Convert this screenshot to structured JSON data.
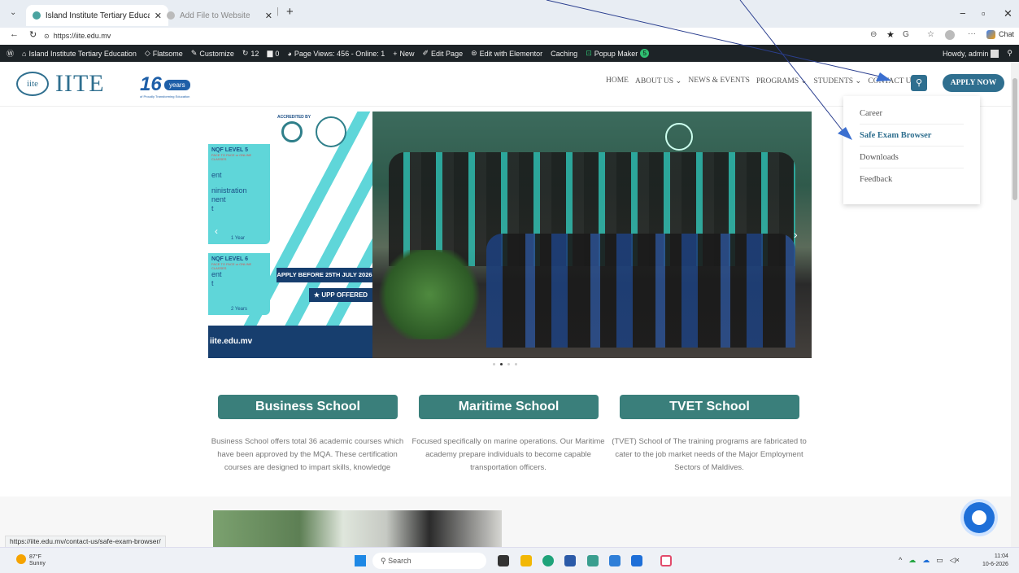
{
  "browser": {
    "active_tab": "Island Institute Tertiary Education",
    "inactive_tab": "Add File to Website",
    "new_tab": "+",
    "url": "https://iite.edu.mv",
    "chat_label": "Chat"
  },
  "wp_admin_bar": {
    "site_name": "Island Institute Tertiary Education",
    "theme": "Flatsome",
    "customize": "Customize",
    "updates": "12",
    "comments": "0",
    "page_views": "Page Views: 456 - Online: 1",
    "new": "New",
    "edit_page": "Edit Page",
    "edit_elementor": "Edit with Elementor",
    "caching": "Caching",
    "popup_maker": "Popup Maker",
    "popup_count": "5",
    "howdy": "Howdy, admin"
  },
  "header": {
    "logo_text": "IITE",
    "years_num": "16",
    "years_label": "years",
    "years_sub": "of Proudly Transforming Education",
    "nav": [
      "HOME",
      "ABOUT US ⌄",
      "NEWS & EVENTS",
      "PROGRAMS ⌄",
      "STUDENTS ⌄",
      "CONTACT US ⌄"
    ],
    "apply_label": "APPLY NOW"
  },
  "dropdown": {
    "items": [
      "Career",
      "Safe Exam Browser",
      "Downloads",
      "Feedback"
    ]
  },
  "hero": {
    "accredited": "ACCREDITED BY",
    "card1": {
      "level": "NQF LEVEL 5",
      "tag": "FACE TO FACE or ONLINE CLASSES",
      "lines": [
        "ent",
        "ninistration",
        "nent",
        "t"
      ],
      "duration": "1 Year"
    },
    "card2": {
      "level": "NQF LEVEL 6",
      "tag": "FACE TO FACE or ONLINE CLASSES",
      "lines": [
        "ent",
        "t"
      ],
      "duration": "2 Years"
    },
    "apply_before": "APPLY BEFORE 25TH JULY 2026",
    "upp": "★ UPP OFFERED",
    "site": "iite.edu.mv"
  },
  "schools": [
    {
      "name": "Business School",
      "desc": "Business School offers total 36 academic courses which have been approved by the MQA. These certification courses are designed to impart skills, knowledge"
    },
    {
      "name": "Maritime School",
      "desc": "Focused specifically on marine operations. Our Maritime academy prepare individuals to become capable transportation officers."
    },
    {
      "name": "TVET School",
      "desc": "(TVET) School of The training programs are fabricated to cater to the job market needs of the Major Employment Sectors of Maldives."
    }
  ],
  "status_url": "https://iite.edu.mv/contact-us/safe-exam-browser/",
  "taskbar": {
    "temp": "87°F",
    "weather": "Sunny",
    "search": "Search",
    "time": "11:04",
    "date": "10-6-2026"
  },
  "colors": {
    "brand": "#2f6f8f",
    "school_button": "#3a7f7b",
    "admin_bar": "#1d2327"
  }
}
